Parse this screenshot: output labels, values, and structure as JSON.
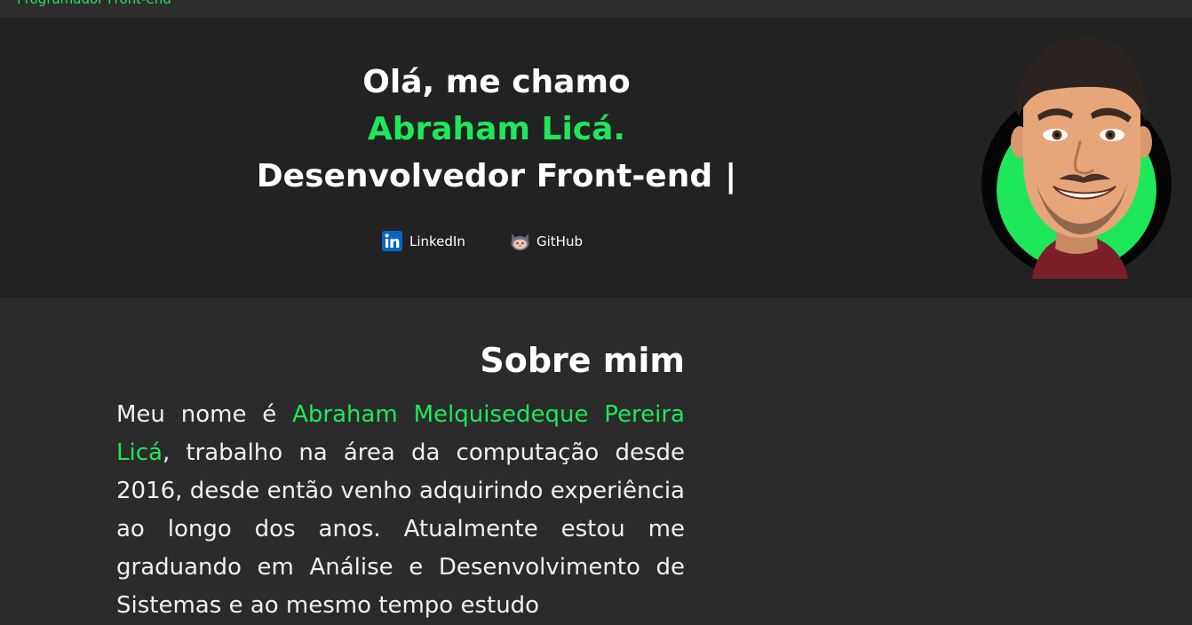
{
  "header": {
    "subtitle": "Programador Front-end"
  },
  "hero": {
    "greeting": "Olá, me chamo",
    "name": "Abraham Licá.",
    "role": "Desenvolvedor Front-end",
    "cursor": "|",
    "links": [
      {
        "label": "LinkedIn",
        "icon": "linkedin-icon"
      },
      {
        "label": "GitHub",
        "icon": "github-icon"
      }
    ],
    "avatar_ring_color": "#1ee85a"
  },
  "about": {
    "title": "Sobre mim",
    "text_before": "Meu nome é ",
    "full_name": "Abraham Melquisedeque Pereira Licá",
    "text_after": ", trabalho na área da computação desde 2016, desde então venho adquirindo experiência ao longo dos anos. Atualmente estou me graduando em Análise e Desenvolvimento de Sistemas e ao mesmo tempo estudo"
  },
  "colors": {
    "accent": "#1ee85a",
    "hero_bg": "#222222",
    "page_bg": "#2b2b2b"
  }
}
